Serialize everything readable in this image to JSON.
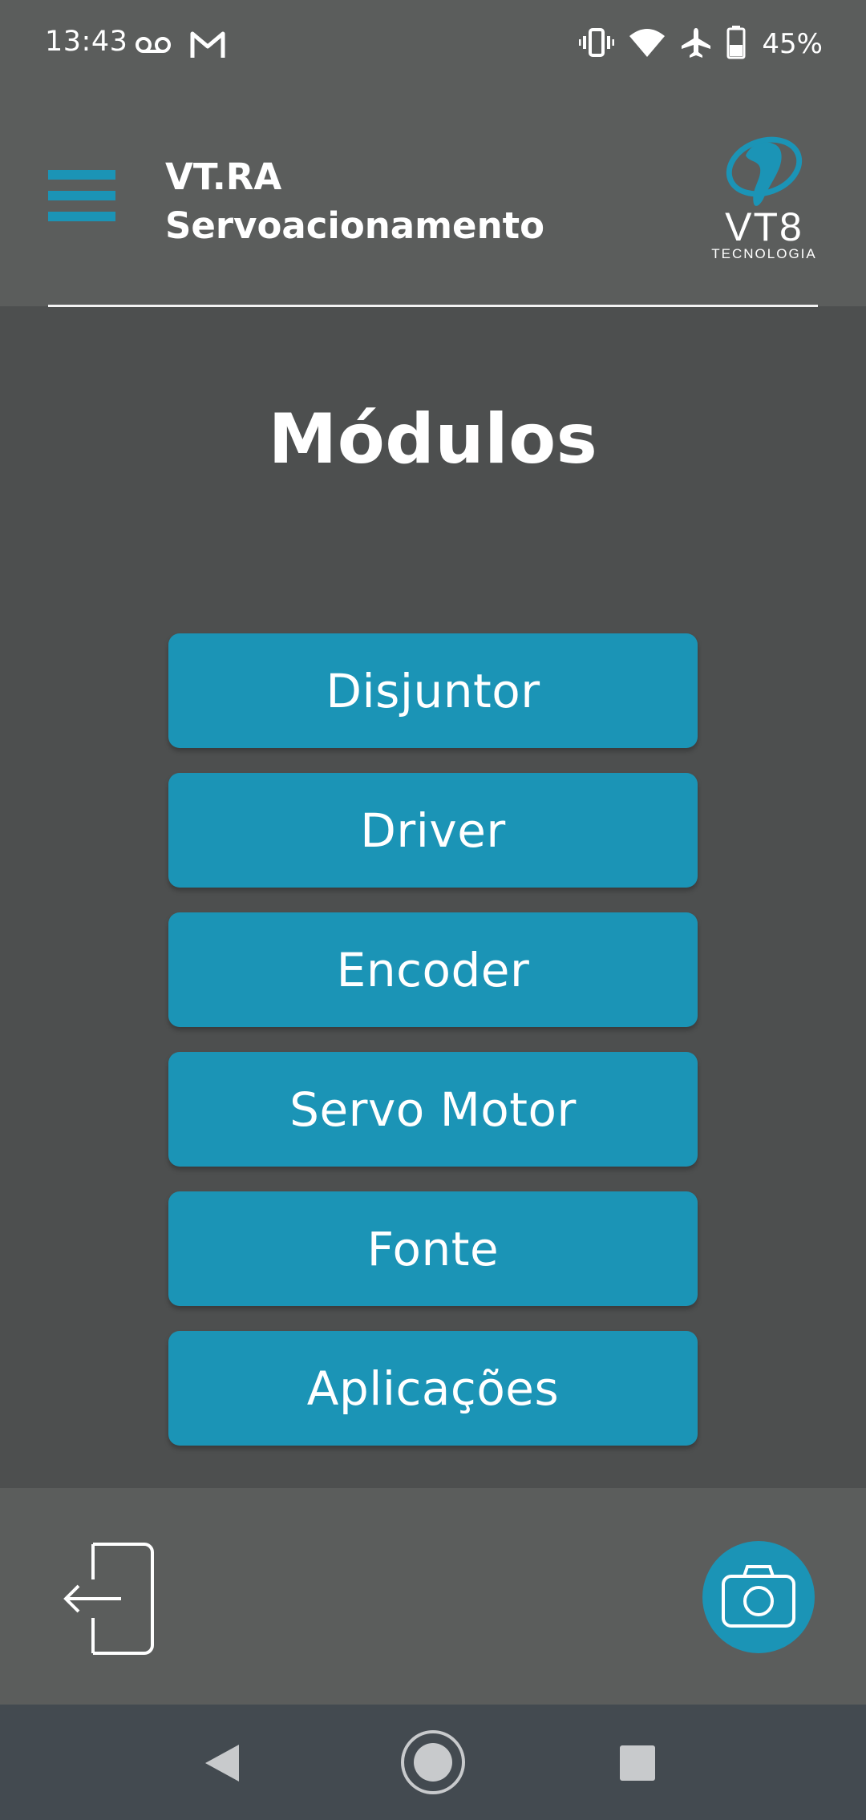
{
  "status_bar": {
    "time": "13:43",
    "left_icons": [
      "voicemail-icon",
      "gmail-icon"
    ],
    "right_icons": [
      "vibrate-icon",
      "wifi-icon",
      "airplane-mode-icon",
      "battery-icon"
    ],
    "battery_percent": "45%",
    "battery_level": 0.45
  },
  "header": {
    "title_line1": "VT.RA",
    "title_line2": "Servoacionamento",
    "logo_text": "VT8",
    "logo_subtext": "TECNOLOGIA",
    "menu_icon": "hamburger-menu-icon"
  },
  "main": {
    "title": "Módulos",
    "modules": [
      {
        "label": "Disjuntor"
      },
      {
        "label": "Driver"
      },
      {
        "label": "Encoder"
      },
      {
        "label": "Servo Motor"
      },
      {
        "label": "Fonte"
      },
      {
        "label": "Aplicações"
      }
    ]
  },
  "bottom_bar": {
    "logout_icon": "logout-icon",
    "camera_icon": "camera-icon"
  },
  "nav_bar": {
    "buttons": [
      "back-icon",
      "home-icon",
      "recents-icon"
    ]
  },
  "colors": {
    "accent": "#1b94b6",
    "header_bg": "#5b5d5c",
    "body_bg": "#4d4f4f",
    "nav_bg": "#434a50",
    "text": "#ffffff"
  }
}
